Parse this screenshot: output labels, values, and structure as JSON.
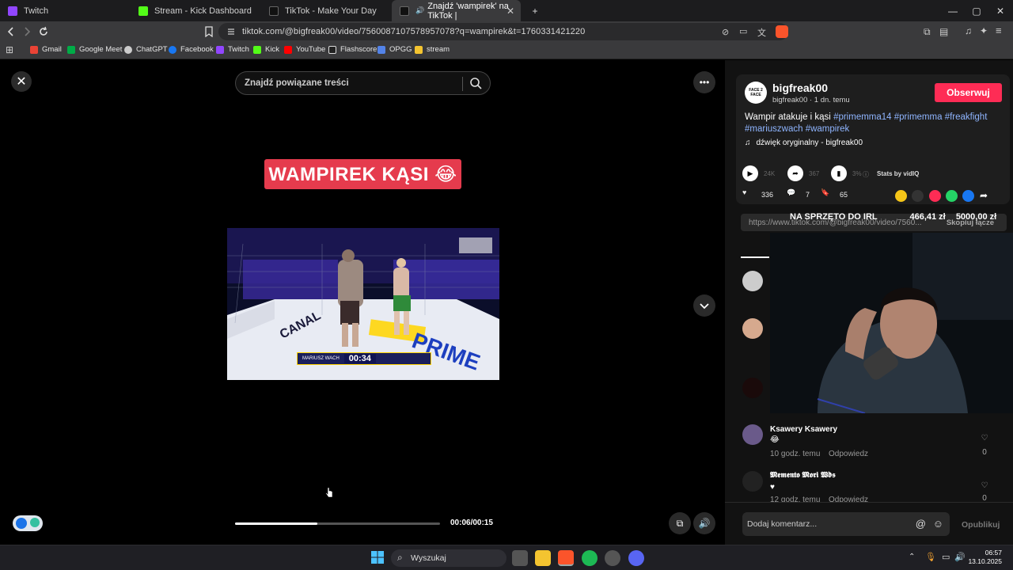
{
  "tabs": [
    {
      "label": "Twitch",
      "color": "#9146ff"
    },
    {
      "label": "Stream - Kick Dashboard",
      "color": "#53fc18"
    },
    {
      "label": "TikTok - Make Your Day",
      "color": "#ffffff"
    },
    {
      "label": "Znajdź 'wampirek' na TikTok |",
      "color": "#ffffff",
      "active": true
    }
  ],
  "new_tab_symbol": "+",
  "window_controls": {
    "minimize": "—",
    "maximize": "▢",
    "close": "✕"
  },
  "address": {
    "url": "tiktok.com/@bigfreak00/video/7560087107578957078?q=wampirek&t=1760331421220"
  },
  "bookmarks": [
    {
      "label": "Gmail",
      "color": "#ea4335"
    },
    {
      "label": "Google Meet",
      "color": "#00ac47"
    },
    {
      "label": "ChatGPT",
      "color": "#cccccc"
    },
    {
      "label": "Facebook",
      "color": "#1877f2"
    },
    {
      "label": "Twitch",
      "color": "#9146ff"
    },
    {
      "label": "Kick",
      "color": "#53fc18"
    },
    {
      "label": "YouTube",
      "color": "#ff0000"
    },
    {
      "label": "Flashscore",
      "color": "#ffffff"
    },
    {
      "label": "OPGG",
      "color": "#5383e8"
    },
    {
      "label": "stream",
      "color": "#f4c430"
    }
  ],
  "video": {
    "search_placeholder": "Znajdź powiązane treści",
    "overlay_title": "WAMPIREK KĄSI 😂",
    "score_time": "00:34",
    "score_name": "MARIUSZ WACH",
    "time": "00:06/00:15",
    "progress": 0.4
  },
  "author": {
    "avatar_text": "FACE 2 FACE",
    "name": "bigfreak00",
    "sub": "bigfreak00 · 1 dn. temu",
    "follow": "Obserwuj"
  },
  "description": {
    "text": "Wampir atakuje i kąsi ",
    "tags": [
      "#primemma14",
      "#primemma",
      "#freakfight",
      "#mariuszwach",
      "#wampirek"
    ]
  },
  "sound": "dźwięk oryginalny - bigfreak00",
  "stats": {
    "plays": "24K",
    "shares": "367",
    "pct": "3%",
    "label": "Stats by vidIQ"
  },
  "actions": {
    "likes": "336",
    "comments": "7",
    "saves": "65"
  },
  "link": {
    "url": "https://www.tiktok.com/@bigfreak00/video/7560...",
    "copy": "Skopiuj łącze"
  },
  "stream_overlay": {
    "text": "NA SPRZĘTO DO IRL",
    "amount": "466,41 zł",
    "goal": "5000,00 zł"
  },
  "comments": [
    {
      "name": "Ksawery Ksawery",
      "text": "😂",
      "time": "10 godz. temu",
      "reply": "Odpowiedz",
      "likes": "0"
    },
    {
      "name": "𝕸𝖊𝖒𝖊𝖓𝖙𝖔 𝕸𝖔𝖗𝖎 𝖂𝖉𝖘",
      "text": "♥",
      "time": "12 godz. temu",
      "reply": "Odpowiedz",
      "likes": "0"
    }
  ],
  "comment_input": {
    "placeholder": "Dodaj komentarz...",
    "publish": "Opublikuj"
  },
  "taskbar": {
    "search": "Wyszukaj",
    "time": "06:57",
    "date": "13.10.2025"
  }
}
